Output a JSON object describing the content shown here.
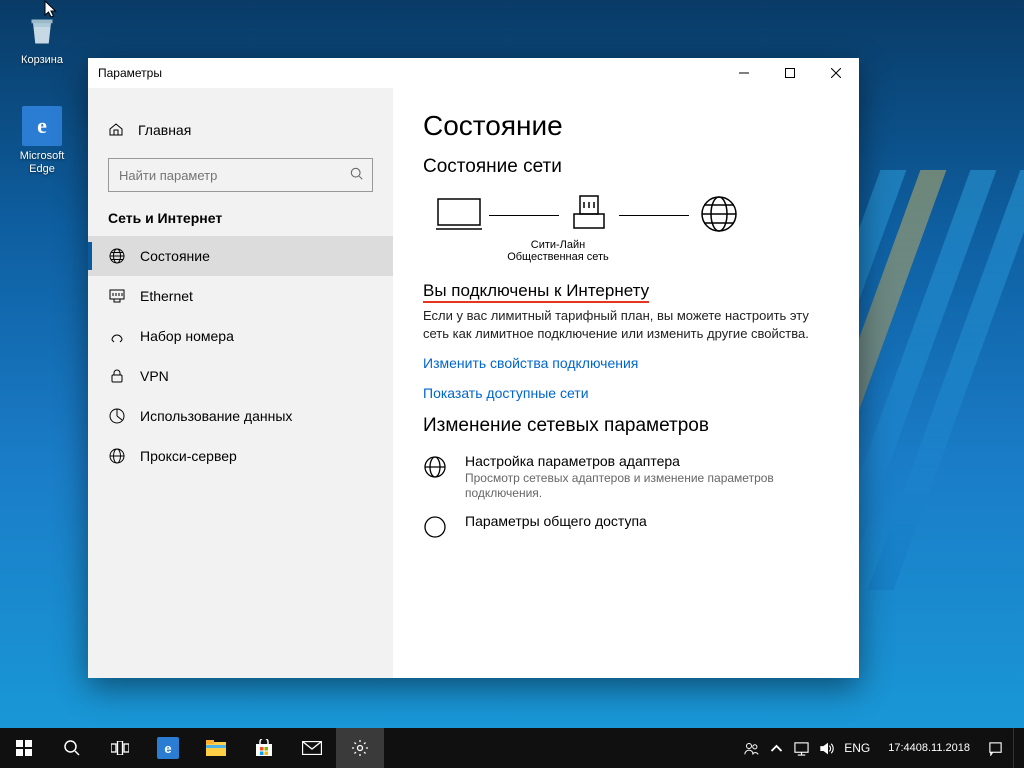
{
  "desktop": {
    "icons": {
      "recycle_bin": "Корзина",
      "edge": "Microsoft Edge"
    }
  },
  "window": {
    "title": "Параметры"
  },
  "sidebar": {
    "home": "Главная",
    "search_placeholder": "Найти параметр",
    "section": "Сеть и Интернет",
    "items": [
      {
        "label": "Состояние"
      },
      {
        "label": "Ethernet"
      },
      {
        "label": "Набор номера"
      },
      {
        "label": "VPN"
      },
      {
        "label": "Использование данных"
      },
      {
        "label": "Прокси-сервер"
      }
    ]
  },
  "content": {
    "title": "Состояние",
    "subtitle": "Состояние сети",
    "diagram": {
      "network_name": "Сити-Лайн",
      "network_type": "Общественная сеть"
    },
    "connected_heading": "Вы подключены к Интернету",
    "connected_desc": "Если у вас лимитный тарифный план, вы можете настроить эту сеть как лимитное подключение или изменить другие свойства.",
    "link_change_props": "Изменить свойства подключения",
    "link_show_networks": "Показать доступные сети",
    "change_settings_heading": "Изменение сетевых параметров",
    "adapter": {
      "title": "Настройка параметров адаптера",
      "desc": "Просмотр сетевых адаптеров и изменение параметров подключения."
    },
    "sharing": {
      "title": "Параметры общего доступа"
    }
  },
  "taskbar": {
    "lang": "ENG",
    "time": "17:44",
    "date": "08.11.2018"
  }
}
